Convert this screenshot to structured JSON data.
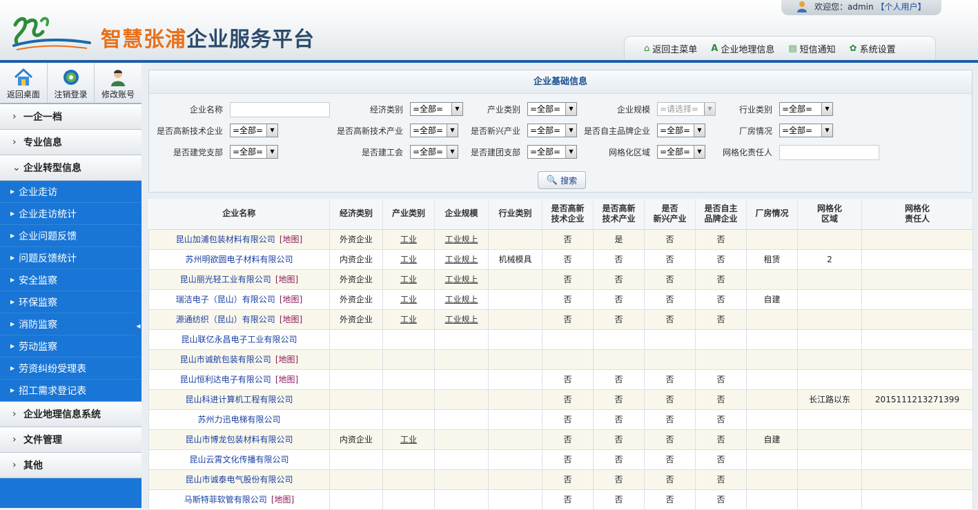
{
  "header": {
    "logo_title_a": "智慧张浦",
    "logo_title_b": "企业服务平台",
    "welcome_prefix": "欢迎您：",
    "username": "admin",
    "role_link": "【个人用户】",
    "nav": [
      {
        "label": "返回主菜单",
        "icon": "home-icon"
      },
      {
        "label": "企业地理信息",
        "icon": "map-marker-icon"
      },
      {
        "label": "短信通知",
        "icon": "message-icon"
      },
      {
        "label": "系统设置",
        "icon": "gear-icon"
      }
    ]
  },
  "sidebar": {
    "quick": [
      {
        "label": "返回桌面",
        "icon": "house-icon"
      },
      {
        "label": "注销登录",
        "icon": "logout-icon"
      },
      {
        "label": "修改账号",
        "icon": "user-icon"
      }
    ],
    "groups_top": [
      {
        "label": "一企一档"
      },
      {
        "label": "专业信息"
      },
      {
        "label": "企业转型信息"
      }
    ],
    "sub_items": [
      "企业走访",
      "企业走访统计",
      "企业问题反馈",
      "问题反馈统计",
      "安全监察",
      "环保监察",
      "消防监察",
      "劳动监察",
      "劳资纠纷受理表",
      "招工需求登记表"
    ],
    "groups_bottom": [
      {
        "label": "企业地理信息系统"
      },
      {
        "label": "文件管理"
      },
      {
        "label": "其他"
      }
    ]
  },
  "search": {
    "title": "企业基础信息",
    "labels": {
      "company_name": "企业名称",
      "econ_type": "经济类别",
      "industry_type": "产业类别",
      "scale": "企业规模",
      "sector": "行业类别",
      "hightech_enterprise": "是否高新技术企业",
      "hightech_industry": "是否高新技术产业",
      "emerging": "是否新兴产业",
      "brand": "是否自主品牌企业",
      "plant": "厂房情况",
      "party": "是否建党支部",
      "union": "是否建工会",
      "league": "是否建团支部",
      "grid_area": "网格化区域",
      "grid_owner": "网格化责任人"
    },
    "all_option": "=全部=",
    "select_option": "=请选择=",
    "button": "搜索"
  },
  "table": {
    "headers": [
      "企业名称",
      "经济类别",
      "产业类别",
      "企业规模",
      "行业类别",
      "是否高新\n技术企业",
      "是否高新\n技术产业",
      "是否\n新兴产业",
      "是否自主\n品牌企业",
      "厂房情况",
      "网格化\n区域",
      "网格化\n责任人"
    ],
    "map_link": "[地图]",
    "rows": [
      {
        "name": "昆山加浦包装材料有限公司",
        "map": true,
        "econ": "外资企业",
        "ind": "工业",
        "scale": "工业规上",
        "sector": "",
        "c1": "否",
        "c2": "是",
        "c3": "否",
        "c4": "否",
        "plant": "",
        "area": "",
        "owner": ""
      },
      {
        "name": "苏州明欲圆电子材料有限公司",
        "map": false,
        "econ": "内资企业",
        "ind": "工业",
        "scale": "工业规上",
        "sector": "机械模具",
        "c1": "否",
        "c2": "否",
        "c3": "否",
        "c4": "否",
        "plant": "租赁",
        "area": "2",
        "owner": ""
      },
      {
        "name": "昆山丽光轻工业有限公司",
        "map": true,
        "econ": "外资企业",
        "ind": "工业",
        "scale": "工业规上",
        "sector": "",
        "c1": "否",
        "c2": "否",
        "c3": "否",
        "c4": "否",
        "plant": "",
        "area": "",
        "owner": ""
      },
      {
        "name": "瑞洁电子（昆山）有限公司",
        "map": true,
        "econ": "外资企业",
        "ind": "工业",
        "scale": "工业规上",
        "sector": "",
        "c1": "否",
        "c2": "否",
        "c3": "否",
        "c4": "否",
        "plant": "自建",
        "area": "",
        "owner": ""
      },
      {
        "name": "源通纺织（昆山）有限公司",
        "map": true,
        "econ": "外资企业",
        "ind": "工业",
        "scale": "工业规上",
        "sector": "",
        "c1": "否",
        "c2": "否",
        "c3": "否",
        "c4": "否",
        "plant": "",
        "area": "",
        "owner": ""
      },
      {
        "name": "昆山联亿永昌电子工业有限公司",
        "map": false,
        "econ": "",
        "ind": "",
        "scale": "",
        "sector": "",
        "c1": "",
        "c2": "",
        "c3": "",
        "c4": "",
        "plant": "",
        "area": "",
        "owner": ""
      },
      {
        "name": "昆山市诚航包装有限公司",
        "map": true,
        "econ": "",
        "ind": "",
        "scale": "",
        "sector": "",
        "c1": "",
        "c2": "",
        "c3": "",
        "c4": "",
        "plant": "",
        "area": "",
        "owner": ""
      },
      {
        "name": "昆山恒利达电子有限公司",
        "map": true,
        "econ": "",
        "ind": "",
        "scale": "",
        "sector": "",
        "c1": "否",
        "c2": "否",
        "c3": "否",
        "c4": "否",
        "plant": "",
        "area": "",
        "owner": ""
      },
      {
        "name": "昆山科进计算机工程有限公司",
        "map": false,
        "econ": "",
        "ind": "",
        "scale": "",
        "sector": "",
        "c1": "否",
        "c2": "否",
        "c3": "否",
        "c4": "否",
        "plant": "",
        "area": "长江路以东",
        "owner": "2015111213271399"
      },
      {
        "name": "苏州力迅电梯有限公司",
        "map": false,
        "econ": "",
        "ind": "",
        "scale": "",
        "sector": "",
        "c1": "否",
        "c2": "否",
        "c3": "否",
        "c4": "否",
        "plant": "",
        "area": "",
        "owner": ""
      },
      {
        "name": "昆山市博龙包装材料有限公司",
        "map": false,
        "econ": "内资企业",
        "ind": "工业",
        "scale": "",
        "sector": "",
        "c1": "否",
        "c2": "否",
        "c3": "否",
        "c4": "否",
        "plant": "自建",
        "area": "",
        "owner": ""
      },
      {
        "name": "昆山云霄文化传播有限公司",
        "map": false,
        "econ": "",
        "ind": "",
        "scale": "",
        "sector": "",
        "c1": "否",
        "c2": "否",
        "c3": "否",
        "c4": "否",
        "plant": "",
        "area": "",
        "owner": ""
      },
      {
        "name": "昆山市诚泰电气股份有限公司",
        "map": false,
        "econ": "",
        "ind": "",
        "scale": "",
        "sector": "",
        "c1": "否",
        "c2": "否",
        "c3": "否",
        "c4": "否",
        "plant": "",
        "area": "",
        "owner": ""
      },
      {
        "name": "马斯特菲软管有限公司",
        "map": true,
        "econ": "",
        "ind": "",
        "scale": "",
        "sector": "",
        "c1": "否",
        "c2": "否",
        "c3": "否",
        "c4": "否",
        "plant": "",
        "area": "",
        "owner": ""
      }
    ]
  }
}
